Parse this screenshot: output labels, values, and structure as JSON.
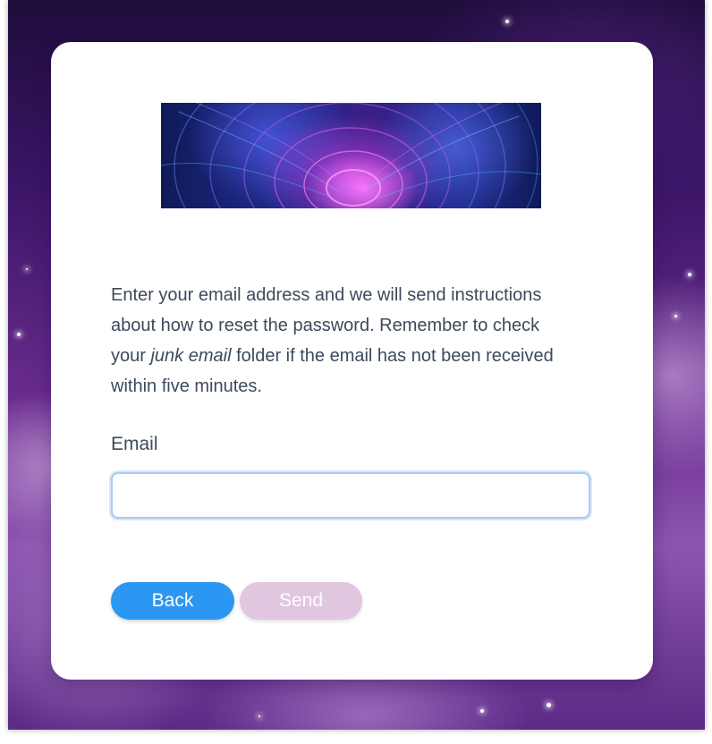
{
  "form": {
    "description_part1": "Enter your email address and we will send instructions about how to reset the password. Remember to check your ",
    "description_emphasis": "junk email",
    "description_part2": " folder if the email has not been received within five minutes.",
    "email_label": "Email",
    "email_value": "",
    "email_placeholder": ""
  },
  "buttons": {
    "back_label": "Back",
    "send_label": "Send"
  },
  "colors": {
    "back_button": "#2b97f2",
    "send_button_disabled": "#e1c6df",
    "input_focus_border": "#a9c9f5",
    "text": "#3c4a5c"
  }
}
